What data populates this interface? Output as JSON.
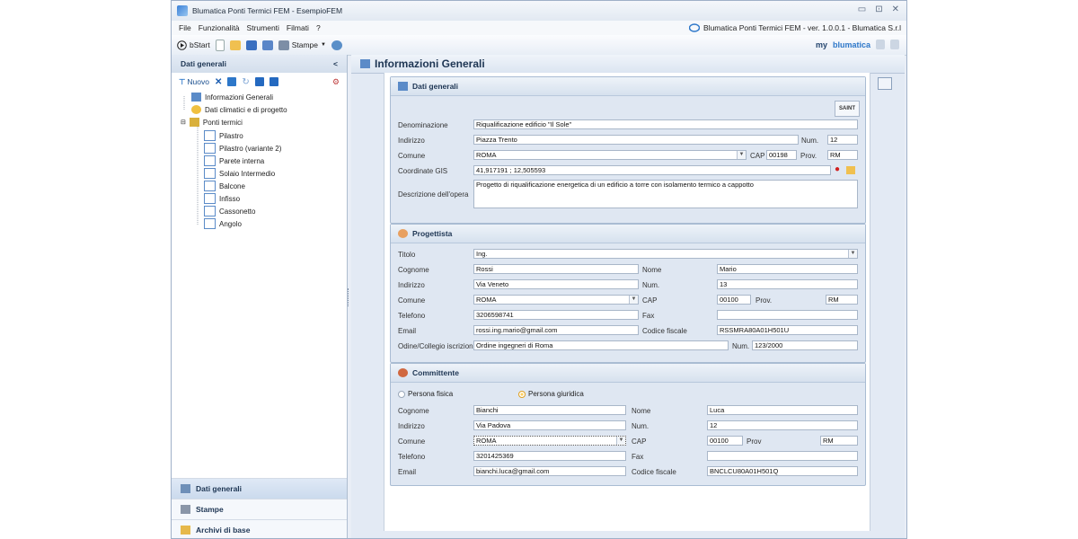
{
  "window": {
    "title": "Blumatica Ponti Termici FEM - EsempioFEM",
    "version_label": "Blumatica Ponti Termici FEM - ver. 1.0.0.1 - Blumatica S.r.l",
    "controls": [
      "▭",
      "⊡",
      "✕"
    ]
  },
  "menu": [
    "File",
    "Funzionalità",
    "Strumenti",
    "Filmati",
    "?"
  ],
  "toolbar": {
    "start_label": "bStart",
    "print_label": "Stampe",
    "brand_my": "my",
    "brand_name": "blumatica"
  },
  "sidebar": {
    "title": "Dati generali",
    "collapse": "<",
    "new_label": "Nuovo",
    "tree": [
      {
        "label": "Informazioni Generali"
      },
      {
        "label": "Dati climatici e di progetto"
      },
      {
        "label": "Ponti termici"
      },
      {
        "label": "Pilastro"
      },
      {
        "label": "Pilastro (variante 2)"
      },
      {
        "label": "Parete interna"
      },
      {
        "label": "Solaio Intermedio"
      },
      {
        "label": "Balcone"
      },
      {
        "label": "Infisso"
      },
      {
        "label": "Cassonetto"
      },
      {
        "label": "Angolo"
      }
    ],
    "bottom": [
      {
        "label": "Dati generali"
      },
      {
        "label": "Stampe"
      },
      {
        "label": "Archivi di base"
      }
    ]
  },
  "main": {
    "title": "Informazioni Generali"
  },
  "dati_generali": {
    "title": "Dati generali",
    "saint_label": "SAINT",
    "denominazione_label": "Denominazione",
    "denominazione": "Riqualificazione edificio \"Il Sole\"",
    "indirizzo_label": "Indirizzo",
    "indirizzo": "Piazza Trento",
    "num_label": "Num.",
    "num": "12",
    "comune_label": "Comune",
    "comune": "ROMA",
    "cap_label": "CAP",
    "cap": "00198",
    "prov_label": "Prov.",
    "prov": "RM",
    "gis_label": "Coordinate GIS",
    "gis": "41,917191 ; 12,505593",
    "descrizione_label": "Descrizione dell'opera",
    "descrizione": "Progetto di riqualificazione energetica di un edificio a torre con isolamento termico a cappotto"
  },
  "progettista": {
    "title": "Progettista",
    "titolo_label": "Titolo",
    "titolo": "Ing.",
    "cognome_label": "Cognome",
    "cognome": "Rossi",
    "nome_label": "Nome",
    "nome": "Mario",
    "indirizzo_label": "Indirizzo",
    "indirizzo": "Via Veneto",
    "num_label": "Num.",
    "num": "13",
    "comune_label": "Comune",
    "comune": "ROMA",
    "cap_label": "CAP",
    "cap": "00100",
    "prov_label": "Prov.",
    "prov": "RM",
    "telefono_label": "Telefono",
    "telefono": "3206598741",
    "fax_label": "Fax",
    "fax": "",
    "email_label": "Email",
    "email": "rossi.ing.mario@gmail.com",
    "cf_label": "Codice fiscale",
    "cf": "RSSMRA80A01H501U",
    "ordine_label": "Odine/Collegio iscrizione",
    "ordine": "Ordine ingegneri di Roma",
    "ordine_num_label": "Num.",
    "ordine_num": "123/2000"
  },
  "committente": {
    "title": "Committente",
    "radio_fisica": "Persona fisica",
    "radio_giuridica": "Persona giuridica",
    "cognome_label": "Cognome",
    "cognome": "Bianchi",
    "nome_label": "Nome",
    "nome": "Luca",
    "indirizzo_label": "Indirizzo",
    "indirizzo": "Via Padova",
    "num_label": "Num.",
    "num": "12",
    "comune_label": "Comune",
    "comune": "ROMA",
    "cap_label": "CAP",
    "cap": "00100",
    "prov_label": "Prov",
    "prov": "RM",
    "telefono_label": "Telefono",
    "telefono": "3201425369",
    "fax_label": "Fax",
    "fax": "",
    "email_label": "Email",
    "email": "bianchi.luca@gmail.com",
    "cf_label": "Codice fiscale",
    "cf": "BNCLCU80A01H501Q"
  }
}
